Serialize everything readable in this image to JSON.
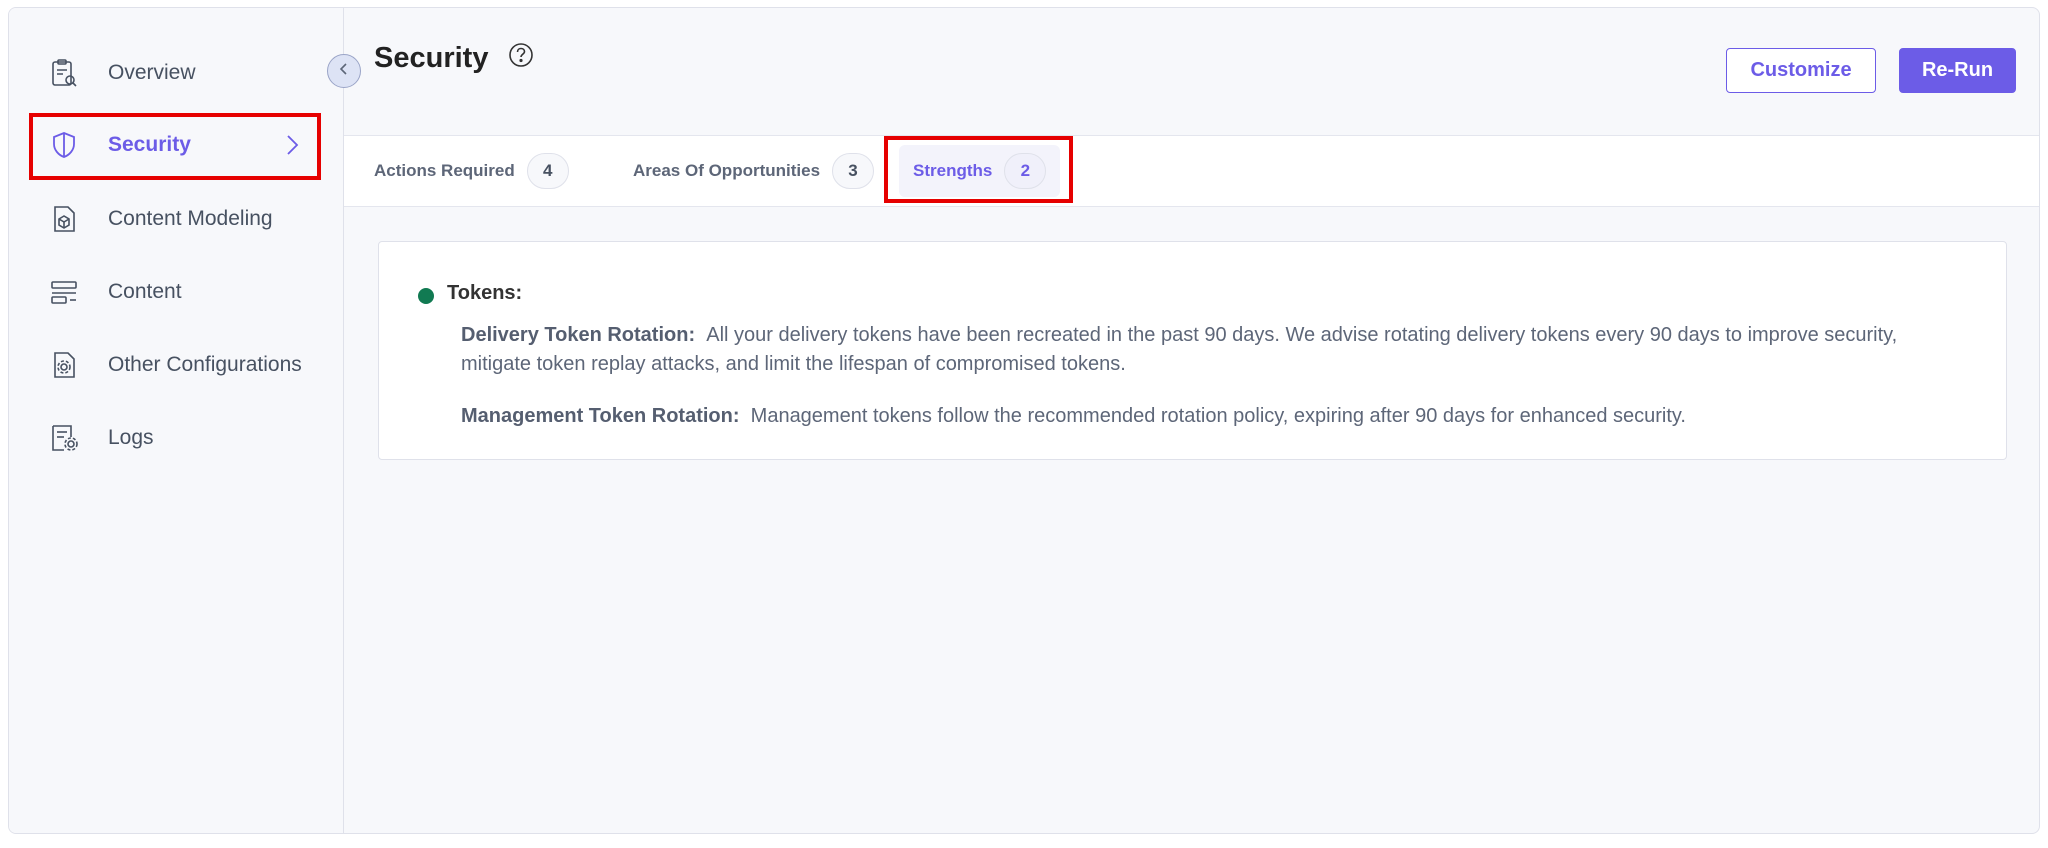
{
  "sidebar": {
    "items": [
      {
        "label": "Overview",
        "icon": "clipboard-search-icon"
      },
      {
        "label": "Security",
        "icon": "shield-icon",
        "active": true
      },
      {
        "label": "Content Modeling",
        "icon": "document-cube-icon"
      },
      {
        "label": "Content",
        "icon": "content-list-icon"
      },
      {
        "label": "Other Configurations",
        "icon": "document-gear-icon"
      },
      {
        "label": "Logs",
        "icon": "log-gear-icon"
      }
    ]
  },
  "header": {
    "title": "Security",
    "customize_label": "Customize",
    "rerun_label": "Re-Run"
  },
  "tabs": [
    {
      "label": "Actions Required",
      "count": "4"
    },
    {
      "label": "Areas Of Opportunities",
      "count": "3"
    },
    {
      "label": "Strengths",
      "count": "2",
      "active": true
    }
  ],
  "main": {
    "section_title": "Tokens:",
    "items": [
      {
        "title": "Delivery Token Rotation:",
        "text": "All your delivery tokens have been recreated in the past 90 days. We advise rotating delivery tokens every 90 days to improve security, mitigate token replay attacks, and limit the lifespan of compromised tokens."
      },
      {
        "title": "Management Token Rotation:",
        "text": "Management tokens follow the recommended rotation policy, expiring after 90 days for enhanced security."
      }
    ]
  },
  "colors": {
    "accent": "#6c5ce7",
    "success_dot": "#117a52",
    "highlight": "#e60000"
  }
}
